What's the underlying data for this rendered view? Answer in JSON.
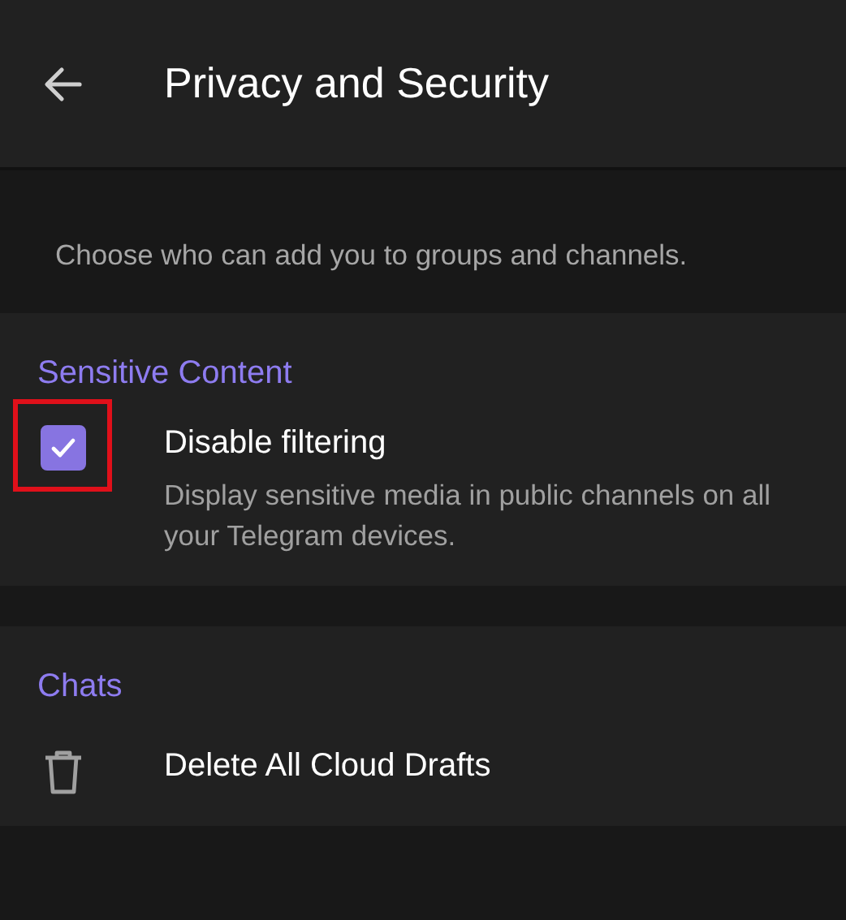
{
  "header": {
    "title": "Privacy and Security"
  },
  "info_text": "Choose who can add you to groups and channels.",
  "sections": [
    {
      "title": "Sensitive Content",
      "items": [
        {
          "kind": "checkbox",
          "label": "Disable filtering",
          "description": "Display sensitive media in public channels on all your Telegram devices.",
          "checked": true,
          "highlighted": true
        }
      ]
    },
    {
      "title": "Chats",
      "items": [
        {
          "kind": "action",
          "label": "Delete All Cloud Drafts"
        }
      ]
    }
  ]
}
